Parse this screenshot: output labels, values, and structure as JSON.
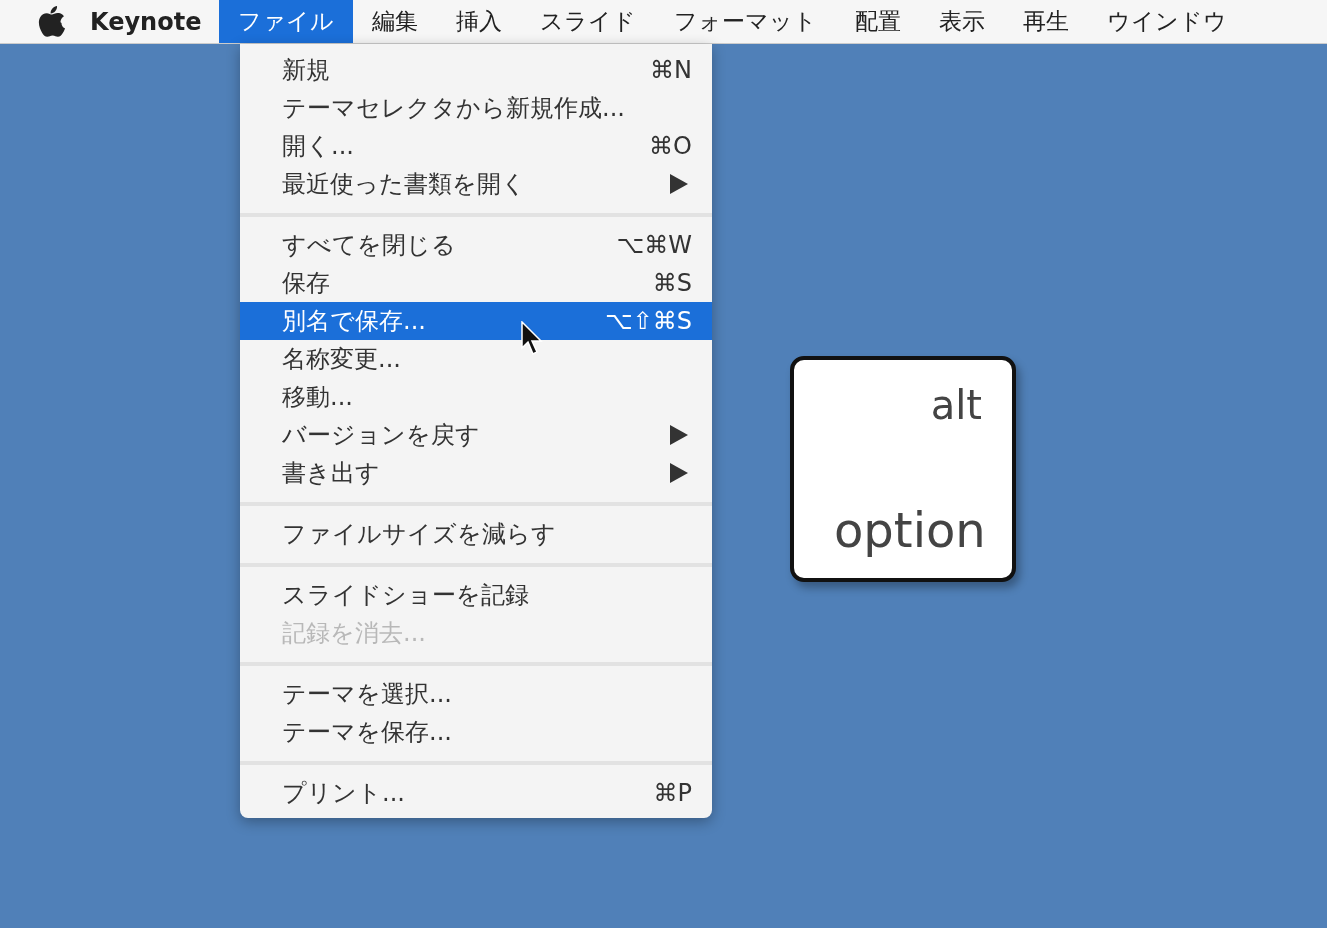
{
  "menubar": {
    "app_name": "Keynote",
    "menus": [
      {
        "label": "ファイル",
        "selected": true
      },
      {
        "label": "編集",
        "selected": false
      },
      {
        "label": "挿入",
        "selected": false
      },
      {
        "label": "スライド",
        "selected": false
      },
      {
        "label": "フォーマット",
        "selected": false
      },
      {
        "label": "配置",
        "selected": false
      },
      {
        "label": "表示",
        "selected": false
      },
      {
        "label": "再生",
        "selected": false
      },
      {
        "label": "ウインドウ",
        "selected": false
      }
    ]
  },
  "file_menu": {
    "groups": [
      [
        {
          "label": "新規",
          "shortcut": "⌘N",
          "submenu": false,
          "selected": false,
          "disabled": false
        },
        {
          "label": "テーマセレクタから新規作成...",
          "submenu": false,
          "selected": false,
          "disabled": false
        },
        {
          "label": "開く...",
          "shortcut": "⌘O",
          "submenu": false,
          "selected": false,
          "disabled": false
        },
        {
          "label": "最近使った書類を開く",
          "submenu": true,
          "selected": false,
          "disabled": false
        }
      ],
      [
        {
          "label": "すべてを閉じる",
          "shortcut": "⌥⌘W",
          "submenu": false,
          "selected": false,
          "disabled": false
        },
        {
          "label": "保存",
          "shortcut": "⌘S",
          "submenu": false,
          "selected": false,
          "disabled": false
        },
        {
          "label": "別名で保存...",
          "shortcut": "⌥⇧⌘S",
          "submenu": false,
          "selected": true,
          "disabled": false
        },
        {
          "label": "名称変更...",
          "submenu": false,
          "selected": false,
          "disabled": false
        },
        {
          "label": "移動...",
          "submenu": false,
          "selected": false,
          "disabled": false
        },
        {
          "label": "バージョンを戻す",
          "submenu": true,
          "selected": false,
          "disabled": false
        },
        {
          "label": "書き出す",
          "submenu": true,
          "selected": false,
          "disabled": false
        }
      ],
      [
        {
          "label": "ファイルサイズを減らす",
          "submenu": false,
          "selected": false,
          "disabled": false
        }
      ],
      [
        {
          "label": "スライドショーを記録",
          "submenu": false,
          "selected": false,
          "disabled": false
        },
        {
          "label": "記録を消去...",
          "submenu": false,
          "selected": false,
          "disabled": true
        }
      ],
      [
        {
          "label": "テーマを選択...",
          "submenu": false,
          "selected": false,
          "disabled": false
        },
        {
          "label": "テーマを保存...",
          "submenu": false,
          "selected": false,
          "disabled": false
        }
      ],
      [
        {
          "label": "プリント...",
          "shortcut": "⌘P",
          "submenu": false,
          "selected": false,
          "disabled": false
        }
      ]
    ]
  },
  "key_cap": {
    "top_label": "alt",
    "bottom_label": "option"
  }
}
